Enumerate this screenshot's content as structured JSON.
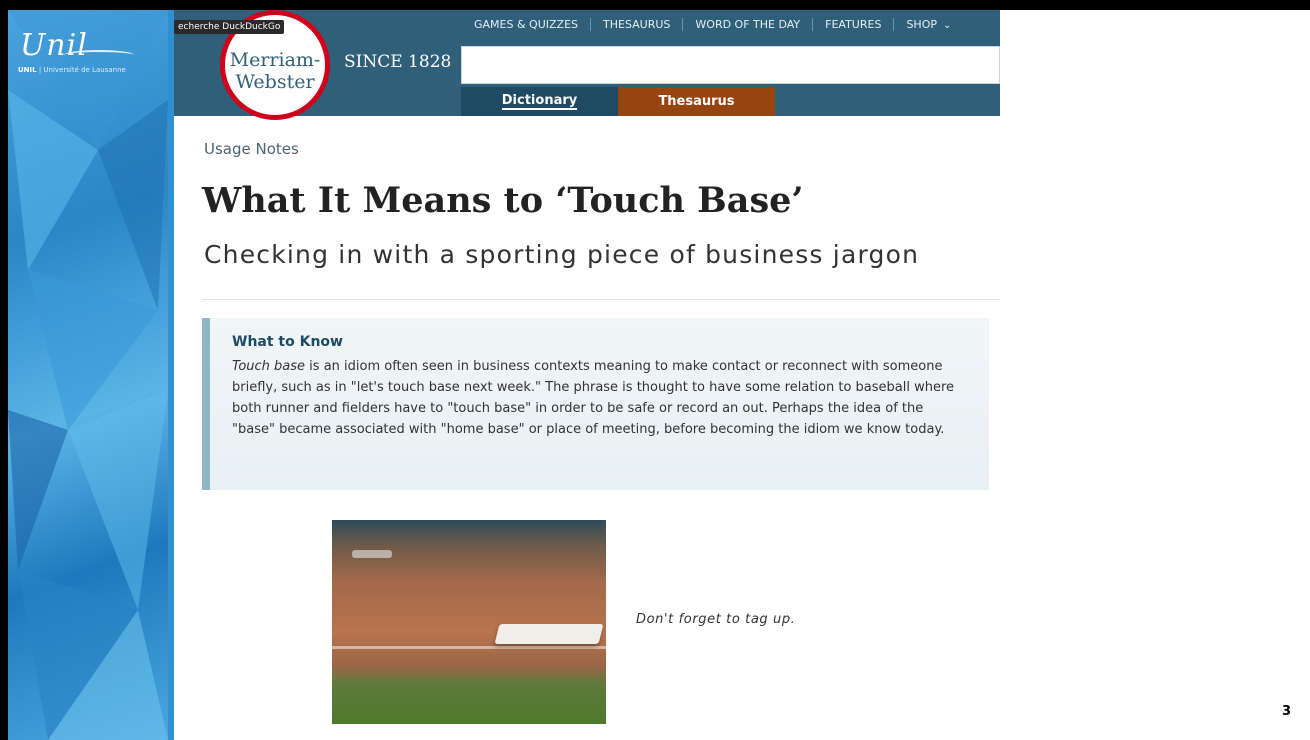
{
  "slide": {
    "logo_text": "Unil",
    "tagline_prefix": "UNIL",
    "tagline_rest": " | Université de Lausanne",
    "page_number": "3"
  },
  "browser": {
    "tooltip": "echerche DuckDuckGo"
  },
  "site": {
    "logo_line1": "Merriam-",
    "logo_line2": "Webster",
    "since": "SINCE 1828",
    "nav": [
      "GAMES & QUIZZES",
      "THESAURUS",
      "WORD OF THE DAY",
      "FEATURES",
      "SHOP"
    ],
    "search": {
      "value": "",
      "placeholder": ""
    },
    "tabs": {
      "dictionary": "Dictionary",
      "thesaurus": "Thesaurus"
    },
    "colors": {
      "header": "#305f7a",
      "dictionary_tab": "#1f4a63",
      "thesaurus_tab": "#974410",
      "logo_ring": "#d0021b"
    }
  },
  "article": {
    "section": "Usage Notes",
    "title": "What It Means to ‘Touch Base’",
    "subtitle": "Checking in with a sporting piece of business jargon",
    "what_to_know": {
      "heading": "What to Know",
      "italic_term": "Touch base",
      "body": " is an idiom often seen in business contexts meaning to make contact or reconnect with someone briefly, such as in \"let's touch base next week.\" The phrase is thought to have some relation to baseball where both runner and fielders have to \"touch base\" in order to be safe or record an out. Perhaps the idea of the \"base\" became associated with \"home base\" or place of meeting, before becoming the idiom we know today."
    },
    "image_caption": "Don't forget to tag up."
  }
}
